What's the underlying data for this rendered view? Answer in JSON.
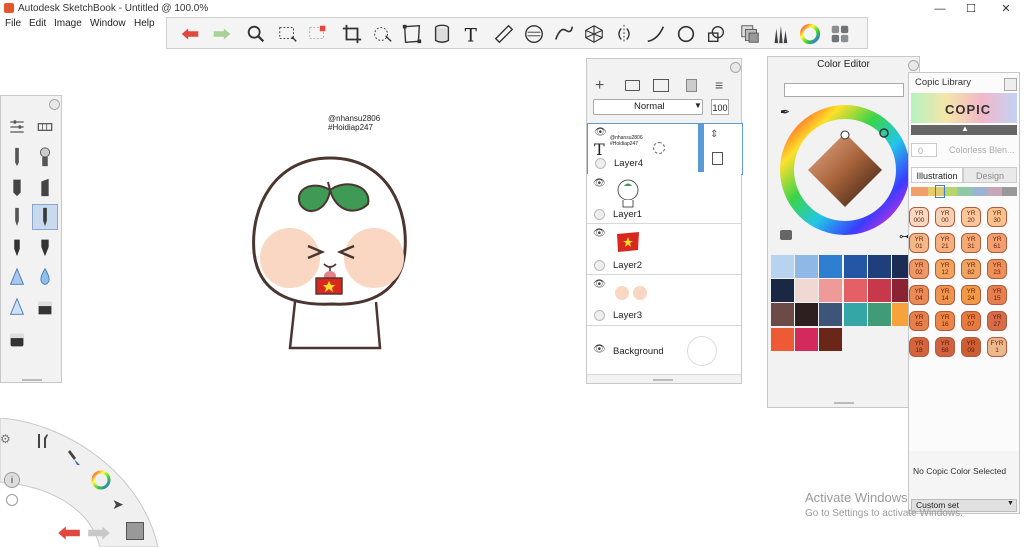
{
  "window": {
    "title": "Autodesk SketchBook - Untitled @ 100.0%",
    "minimize": "—",
    "maximize": "☐",
    "close": "✕"
  },
  "menu": [
    "File",
    "Edit",
    "Image",
    "Window",
    "Help"
  ],
  "toolbar": {
    "icons": [
      "undo-icon",
      "redo-icon",
      "zoom-icon",
      "rect-select-icon",
      "lasso-select-icon",
      "crop-icon",
      "transform-icon",
      "distort-icon",
      "fill-icon",
      "text-icon",
      "ruler-icon",
      "ellipse-guide-icon",
      "french-curve-icon",
      "perspective-icon",
      "symmetry-icon",
      "stroke-icon",
      "ellipse-icon",
      "shape-icon",
      "layer-editor-icon",
      "brush-library-icon",
      "color-wheel-icon",
      "copic-library-icon"
    ],
    "colors": {
      "undo": "#e1473c",
      "redo": "#9bc98a"
    }
  },
  "canvas": {
    "caption_line1": "@nhansu2806",
    "caption_line2": "#Hoidiap247"
  },
  "layers": {
    "blend_mode": "Normal",
    "opacity": "100",
    "items": [
      {
        "name": "Layer4",
        "thumb_line1": "@nhansu2806",
        "thumb_line2": "#Hoidiap247"
      },
      {
        "name": "Layer1"
      },
      {
        "name": "Layer2"
      },
      {
        "name": "Layer3"
      },
      {
        "name": "Background"
      }
    ]
  },
  "color_editor": {
    "title": "Color Editor",
    "hex_value": "",
    "swatches": [
      "#b7d3ef",
      "#8fb8e6",
      "#2f7fd1",
      "#2456a6",
      "#1e3e7c",
      "#1c2d55",
      "#1a2745",
      "#efd9d2",
      "#ee9a98",
      "#e56066",
      "#c6384a",
      "#8b2332",
      "#6b4a48",
      "#2d1f1f",
      "#3d5578",
      "#34a6a6",
      "#3f9c77",
      "#f7a23a",
      "#ee5a35",
      "#d42a5b",
      "#6b261a"
    ]
  },
  "copic": {
    "title": "Copic Library",
    "logo": "COPIC",
    "search_placeholder": "Colorless Blen...",
    "search_number": "0",
    "tabs": [
      "Illustration",
      "Design"
    ],
    "chips": [
      "YR 000",
      "YR 00",
      "YR 20",
      "YR 30",
      "YR 01",
      "YR 21",
      "YR 31",
      "YR 61",
      "YR 02",
      "YR 12",
      "YR 82",
      "YR 23",
      "YR 04",
      "YR 14",
      "YR 24",
      "YR 15",
      "YR 65",
      "YR 16",
      "YR 07",
      "YR 27",
      "YR 18",
      "YR 68",
      "YR 09",
      "FYR 1"
    ],
    "status": "No Copic Color Selected",
    "set_name": "Custom set"
  },
  "watermark": {
    "line1": "Activate Windows",
    "line2": "Go to Settings to activate Windows."
  }
}
